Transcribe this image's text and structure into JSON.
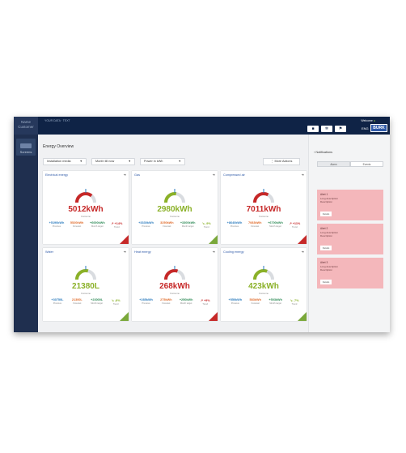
{
  "app": {
    "logo_line1": "Name",
    "logo_line2": "Customer"
  },
  "sidebar": {
    "item_label": "Screens"
  },
  "topbar": {
    "breadcrumb": "YOUR DATA · TEXT",
    "user_label": "Welcome",
    "user_dot": "●",
    "lang": "ENG",
    "brand": "BURK"
  },
  "main": {
    "title": "Energy Overview",
    "filters": [
      {
        "label": "Installation media"
      },
      {
        "label": "Month till now"
      },
      {
        "label": "Power in kWh"
      }
    ],
    "more_label": "More Actions",
    "cards": [
      {
        "title": "Electrical energy",
        "value": "5012kWh",
        "caption": "Consume",
        "color": "#c62828",
        "stats": [
          {
            "v": "+5190kWh",
            "l": "Previous"
          },
          {
            "v": "5520kWh",
            "l": "Forecast"
          },
          {
            "v": "+6000kWh",
            "l": "Month target"
          },
          {
            "v": "↗ +14%",
            "l": "Trend"
          }
        ],
        "level": 0.72
      },
      {
        "title": "Gas",
        "value": "2980kWh",
        "caption": "Consume",
        "color": "#8bb128",
        "stats": [
          {
            "v": "+3330kWh",
            "l": "Previous"
          },
          {
            "v": "3250kWh",
            "l": "Forecast"
          },
          {
            "v": "+3300kWh",
            "l": "Month target"
          },
          {
            "v": "↘ -9%",
            "l": "Trend"
          }
        ],
        "level": 0.55
      },
      {
        "title": "Compressed air",
        "value": "7011kWh",
        "caption": "Consume",
        "color": "#c62828",
        "stats": [
          {
            "v": "+8640kWh",
            "l": "Previous"
          },
          {
            "v": "7083kWh",
            "l": "Forecast"
          },
          {
            "v": "+6700kWh",
            "l": "Month target"
          },
          {
            "v": "↗ +11%",
            "l": "Trend"
          }
        ],
        "level": 0.66
      },
      {
        "title": "Water",
        "value": "21380L",
        "caption": "Consume",
        "color": "#8bb128",
        "stats": [
          {
            "v": "+30750L",
            "l": "Previous"
          },
          {
            "v": "21300L",
            "l": "Forecast"
          },
          {
            "v": "+23000L",
            "l": "Month target"
          },
          {
            "v": "↘ -8%",
            "l": "Trend"
          }
        ],
        "level": 0.58
      },
      {
        "title": "Heat energy",
        "value": "268kWh",
        "caption": "Consume",
        "color": "#c62828",
        "stats": [
          {
            "v": "+285kWh",
            "l": "Previous"
          },
          {
            "v": "275kWh",
            "l": "Forecast"
          },
          {
            "v": "+250kWh",
            "l": "Month target"
          },
          {
            "v": "↗ +9%",
            "l": "Trend"
          }
        ],
        "level": 0.6
      },
      {
        "title": "Cooling energy",
        "value": "423kWh",
        "caption": "Consume",
        "color": "#8bb128",
        "stats": [
          {
            "v": "+550kWh",
            "l": "Previous"
          },
          {
            "v": "583kWh",
            "l": "Forecast"
          },
          {
            "v": "+503kWh",
            "l": "Month target"
          },
          {
            "v": "↘ -7%",
            "l": "Trend"
          }
        ],
        "level": 0.62
      }
    ]
  },
  "notifications": {
    "header": "Notifications",
    "tabs": [
      "Alarm",
      "Events"
    ],
    "alerts": [
      {
        "title": "Alert 1",
        "desc1": "Long description",
        "desc2": "Description",
        "button": "Details"
      },
      {
        "title": "Alert 2",
        "desc1": "Long description",
        "desc2": "Description",
        "button": "Details"
      },
      {
        "title": "Alert 3",
        "desc1": "Long description",
        "desc2": "Description",
        "button": "Details"
      }
    ]
  }
}
